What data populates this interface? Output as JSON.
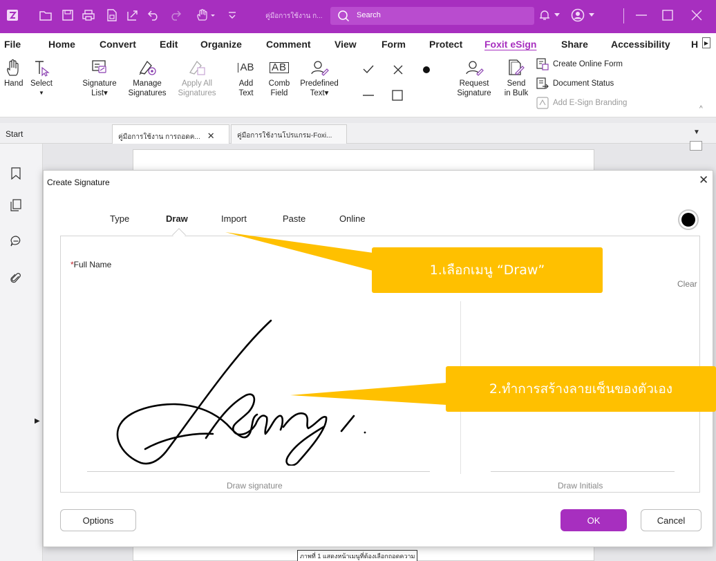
{
  "titlebar": {
    "doc_title": "คู่มือการใช้งาน ก...",
    "search_label": "Search"
  },
  "menu": [
    {
      "label": "File"
    },
    {
      "label": "Home"
    },
    {
      "label": "Convert"
    },
    {
      "label": "Edit"
    },
    {
      "label": "Organize"
    },
    {
      "label": "Comment"
    },
    {
      "label": "View"
    },
    {
      "label": "Form"
    },
    {
      "label": "Protect"
    },
    {
      "label": "Foxit eSign",
      "active": true
    },
    {
      "label": "Share"
    },
    {
      "label": "Accessibility"
    },
    {
      "label": "H"
    }
  ],
  "ribbon": {
    "hand": "Hand",
    "select": "Select",
    "signature_list": [
      "Signature",
      "List▾"
    ],
    "manage_signatures": [
      "Manage",
      "Signatures"
    ],
    "apply_all": [
      "Apply All",
      "Signatures"
    ],
    "add_text": [
      "Add",
      "Text"
    ],
    "add_text_icon_label": "AB",
    "comb_field": [
      "Comb",
      "Field"
    ],
    "comb_field_icon_label": "AB",
    "predefined_text": [
      "Predefined",
      "Text▾"
    ],
    "request_signature": [
      "Request",
      "Signature"
    ],
    "send_in_bulk": [
      "Send",
      "in Bulk"
    ],
    "create_online_form": "Create Online Form",
    "document_status": "Document Status",
    "add_esign_branding": "Add E-Sign Branding"
  },
  "tabs": {
    "start": "Start",
    "doc1": "คู่มือการใช้งาน การถอดค...",
    "doc2": "คู่มือการใช้งานโปรแกรม-Foxi..."
  },
  "page_caption": "ภาพที่ 1 แสดงหน้าเมนูที่ต้องเลือกถอดความ",
  "dialog": {
    "title": "Create Signature",
    "tabs": [
      {
        "label": "Type"
      },
      {
        "label": "Draw",
        "active": true
      },
      {
        "label": "Import"
      },
      {
        "label": "Paste"
      },
      {
        "label": "Online"
      }
    ],
    "ink_color": "#000000",
    "full_name_required": "*",
    "full_name_label": "Full Name",
    "clear": "Clear",
    "draw_signature": "Draw signature",
    "draw_initials": "Draw Initials",
    "options": "Options",
    "ok": "OK",
    "cancel": "Cancel"
  },
  "callouts": {
    "step1": "1.เลือกเมนู “Draw”",
    "step2": "2.ทำการสร้างลายเซ็นของตัวเอง"
  },
  "colors": {
    "brand": "#a72fbf",
    "callout": "#ffc000"
  }
}
